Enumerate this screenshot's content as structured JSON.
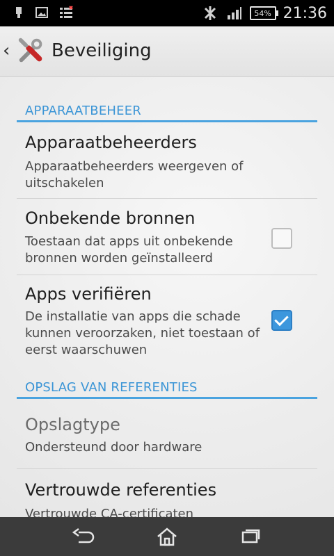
{
  "status_bar": {
    "battery": "54%",
    "time": "21:36"
  },
  "actionbar": {
    "title": "Beveiliging"
  },
  "sections": [
    {
      "title": "APPARAATBEHEER",
      "items": [
        {
          "title": "Apparaatbeheerders",
          "summary": "Apparaatbeheerders weergeven of uitschakelen"
        },
        {
          "title": "Onbekende bronnen",
          "summary": "Toestaan dat apps uit onbekende bronnen worden geïnstalleerd",
          "checked": false
        },
        {
          "title": "Apps verifiëren",
          "summary": "De installatie van apps die schade kunnen veroorzaken, niet toestaan of eerst waarschuwen",
          "checked": true
        }
      ]
    },
    {
      "title": "OPSLAG VAN REFERENTIES",
      "items": [
        {
          "title": "Opslagtype",
          "summary": "Ondersteund door hardware"
        },
        {
          "title": "Vertrouwde referenties",
          "summary": "Vertrouwde CA-certificaten weergeven"
        }
      ]
    }
  ],
  "colors": {
    "accent": "#3b95d6",
    "statusbar": "#000000",
    "navbar": "#3b3b3b"
  },
  "icons": {
    "app_icon": "tools-icon",
    "back": "chevron-left-icon",
    "nav_back": "back-icon",
    "nav_home": "home-icon",
    "nav_recents": "recents-icon"
  }
}
